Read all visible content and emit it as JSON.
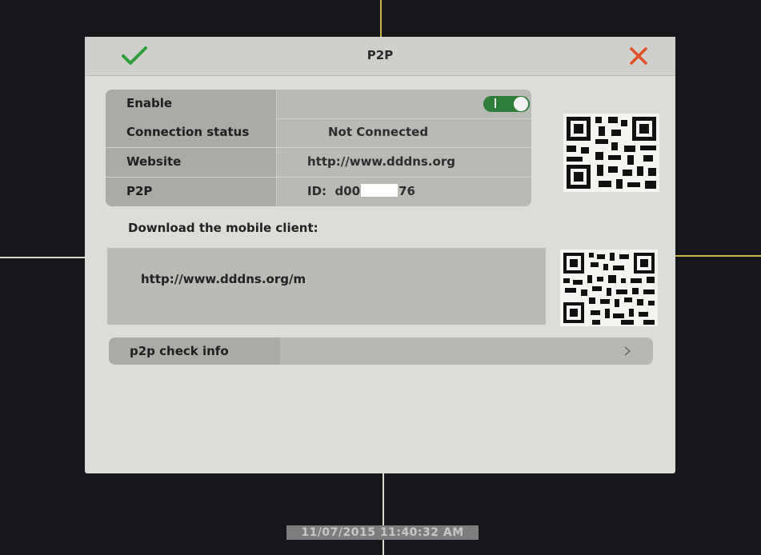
{
  "dialog": {
    "title": "P2P",
    "ok_icon": "checkmark-icon",
    "close_icon": "close-icon",
    "accent_ok": "#2e9e3f",
    "accent_close": "#e0502a"
  },
  "settings": {
    "enable": {
      "label": "Enable",
      "toggle_on": true,
      "toggle_color": "#2e7d3a"
    },
    "connection_status": {
      "label": "Connection status",
      "value": "Not Connected"
    },
    "website": {
      "label": "Website",
      "value": "http://www.dddns.org"
    },
    "p2p": {
      "label": "P2P",
      "id_prefix": "ID:",
      "id_start": "d00",
      "id_end": "76"
    }
  },
  "download": {
    "label": "Download the mobile client:",
    "link": "http://www.dddns.org/m"
  },
  "check_info": {
    "label": "p2p check info",
    "chevron_icon": "chevron-right-icon"
  },
  "qr_codes": [
    "qr-code-icon",
    "qr-code-icon"
  ],
  "timestamp": "11/07/2015 11:40:32 AM"
}
